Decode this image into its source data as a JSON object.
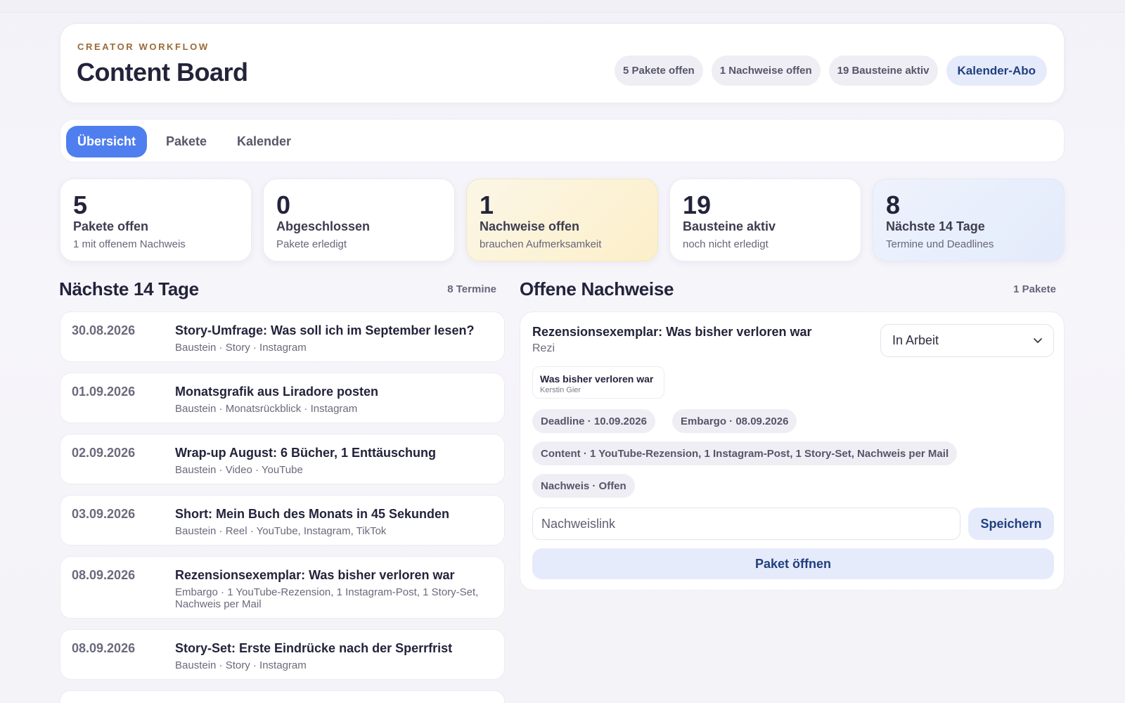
{
  "header": {
    "eyebrow": "CREATOR WORKFLOW",
    "title": "Content Board",
    "pills": [
      "5 Pakete offen",
      "1 Nachweise offen",
      "19 Bausteine aktiv"
    ],
    "calendar_button": "Kalender-Abo"
  },
  "tabs": [
    {
      "label": "Übersicht",
      "active": true
    },
    {
      "label": "Pakete",
      "active": false
    },
    {
      "label": "Kalender",
      "active": false
    }
  ],
  "stats": [
    {
      "value": "5",
      "label": "Pakete offen",
      "sub": "1 mit offenem Nachweis"
    },
    {
      "value": "0",
      "label": "Abgeschlossen",
      "sub": "Pakete erledigt"
    },
    {
      "value": "1",
      "label": "Nachweise offen",
      "sub": "brauchen Aufmerksamkeit"
    },
    {
      "value": "19",
      "label": "Bausteine aktiv",
      "sub": "noch nicht erledigt"
    },
    {
      "value": "8",
      "label": "Nächste 14 Tage",
      "sub": "Termine und Deadlines"
    }
  ],
  "upcoming": {
    "title": "Nächste 14 Tage",
    "count": "8 Termine",
    "events": [
      {
        "date": "30.08.2026",
        "title": "Story-Umfrage: Was soll ich im September lesen?",
        "meta": "Baustein · Story · Instagram"
      },
      {
        "date": "01.09.2026",
        "title": "Monatsgrafik aus Liradore posten",
        "meta": "Baustein · Monatsrückblick · Instagram"
      },
      {
        "date": "02.09.2026",
        "title": "Wrap-up August: 6 Bücher, 1 Enttäuschung",
        "meta": "Baustein · Video · YouTube"
      },
      {
        "date": "03.09.2026",
        "title": "Short: Mein Buch des Monats in 45 Sekunden",
        "meta": "Baustein · Reel · YouTube, Instagram, TikTok"
      },
      {
        "date": "08.09.2026",
        "title": "Rezensionsexemplar: Was bisher verloren war",
        "meta": "Embargo · 1 YouTube-Rezension, 1 Instagram-Post, 1 Story-Set, Nachweis per Mail"
      },
      {
        "date": "08.09.2026",
        "title": "Story-Set: Erste Eindrücke nach der Sperrfrist",
        "meta": "Baustein · Story · Instagram"
      }
    ]
  },
  "proofs": {
    "title": "Offene Nachweise",
    "count": "1 Pakete",
    "item": {
      "title": "Rezensionsexemplar: Was bisher verloren war",
      "type": "Rezi",
      "status": "In Arbeit",
      "book_title": "Was bisher verloren war",
      "book_author": "Kerstin Gier",
      "deadline": "Deadline · 10.09.2026",
      "embargo": "Embargo · 08.09.2026",
      "content": "Content · 1 YouTube-Rezension, 1 Instagram-Post, 1 Story-Set, Nachweis per Mail",
      "proof_status": "Nachweis · Offen",
      "link_placeholder": "Nachweislink",
      "save_label": "Speichern",
      "open_label": "Paket öffnen"
    }
  },
  "colors": {
    "accent": "#4f7fef",
    "eyebrow": "#9a6a35",
    "warn_card": "#fcefc9",
    "info_card": "#e3ebfb",
    "button_bg": "#e5ebfb",
    "button_text": "#213f7e"
  },
  "icons": {
    "select_arrow": "chevron-down-icon"
  }
}
